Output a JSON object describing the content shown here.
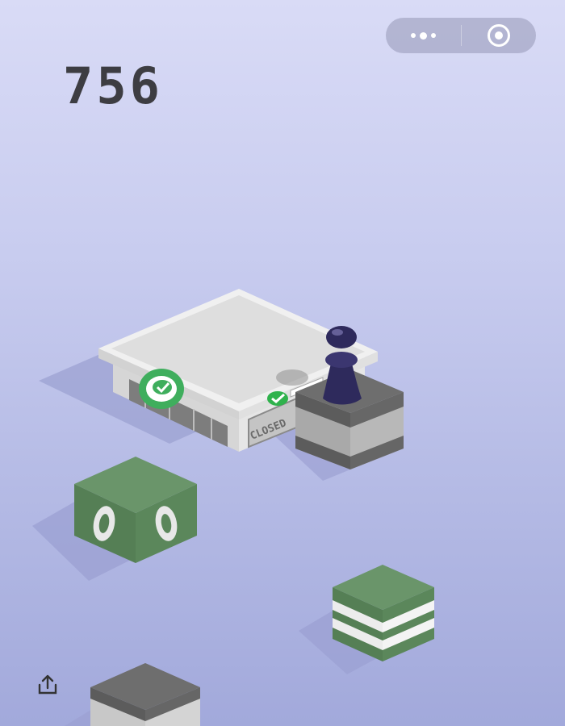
{
  "game": {
    "score": "756",
    "store_sign": "CLOSED"
  },
  "capsule": {
    "more_icon": "more-dots-icon",
    "close_icon": "target-circle-icon"
  },
  "share": {
    "icon": "share-upload-icon"
  },
  "colors": {
    "background_top": "#d9dbf6",
    "background_bottom": "#a2a9db",
    "green_block": "#5f8a5f",
    "gray_block": "#5c5c5c",
    "player": "#2e2a5c",
    "score_text": "#3d3d42"
  }
}
